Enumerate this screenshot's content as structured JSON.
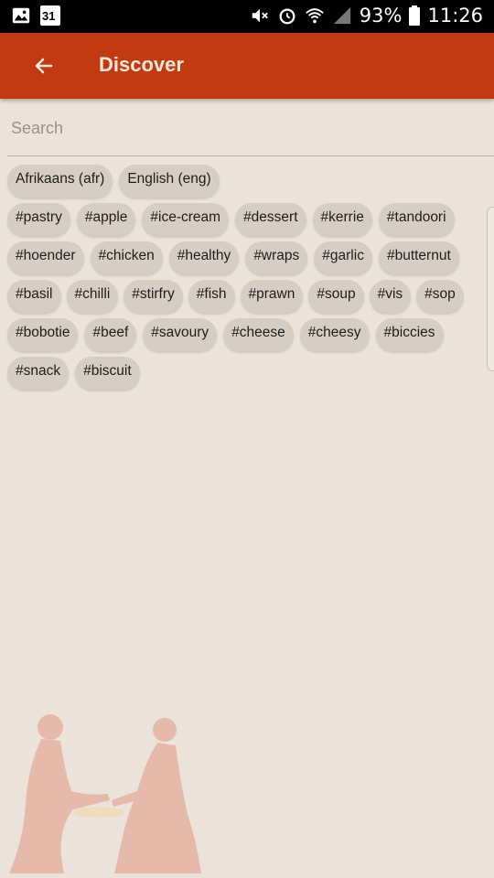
{
  "status_bar": {
    "battery": "93%",
    "time": "11:26",
    "calendar_day": "31"
  },
  "app_bar": {
    "title": "Discover"
  },
  "search": {
    "placeholder": "Search",
    "value": ""
  },
  "languages": [
    "Afrikaans (afr)",
    "English (eng)"
  ],
  "tag_rows": [
    [
      "#pastry",
      "#apple",
      "#ice-cream",
      "#dessert",
      "#kerrie",
      "#tandoori"
    ],
    [
      "#hoender",
      "#chicken",
      "#healthy",
      "#wraps",
      "#garlic",
      "#butternut"
    ],
    [
      "#basil",
      "#chilli",
      "#stirfry",
      "#fish",
      "#prawn",
      "#soup",
      "#vis",
      "#sop"
    ],
    [
      "#bobotie",
      "#beef",
      "#savoury",
      "#cheese",
      "#cheesy",
      "#biccies"
    ],
    [
      "#snack",
      "#biscuit"
    ]
  ],
  "colors": {
    "app_bar": "#c23a10",
    "background": "#ebe3da",
    "chip": "#d6cdc4"
  }
}
